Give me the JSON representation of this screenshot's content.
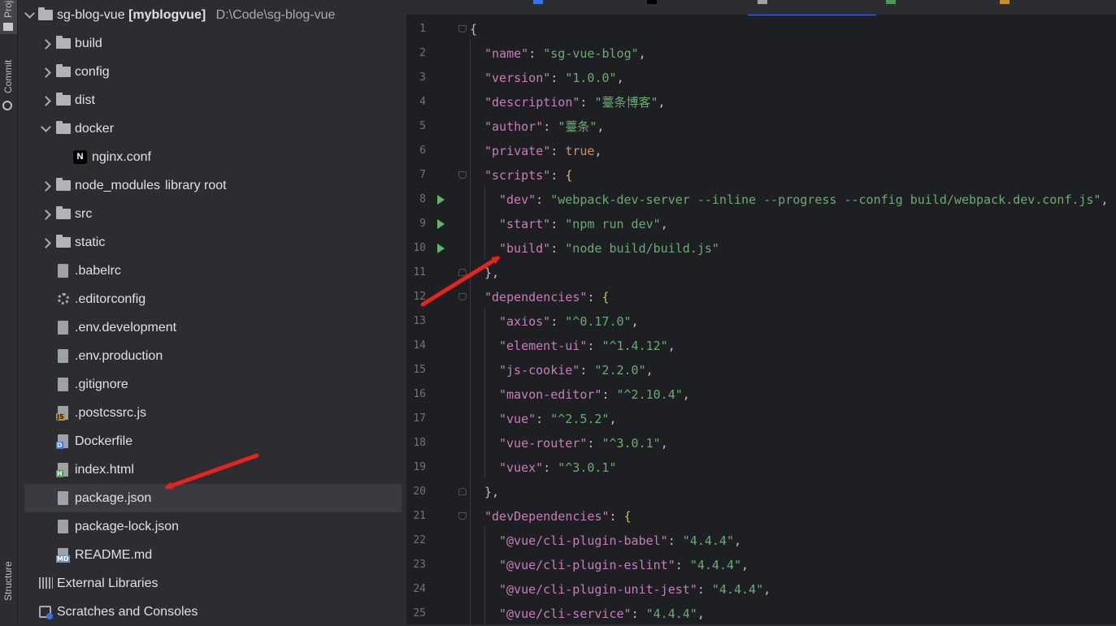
{
  "toolstrip": {
    "project_label": "Project",
    "commit_label": "Commit",
    "structure_label": "Structure"
  },
  "project_tree": {
    "root": {
      "name": "sg-blog-vue",
      "module": "[myblogvue]",
      "path": "D:\\Code\\sg-blog-vue"
    },
    "items": [
      {
        "label": "build",
        "type": "folder",
        "expanded": false
      },
      {
        "label": "config",
        "type": "folder",
        "expanded": false
      },
      {
        "label": "dist",
        "type": "folder",
        "expanded": false
      },
      {
        "label": "docker",
        "type": "folder",
        "expanded": true
      },
      {
        "label": "nginx.conf",
        "type": "nginx-file"
      },
      {
        "label": "node_modules",
        "suffix": "library root",
        "type": "folder",
        "expanded": false
      },
      {
        "label": "src",
        "type": "folder",
        "expanded": false
      },
      {
        "label": "static",
        "type": "folder",
        "expanded": false
      },
      {
        "label": ".babelrc",
        "type": "json-file"
      },
      {
        "label": ".editorconfig",
        "type": "settings-file"
      },
      {
        "label": ".env.development",
        "type": "text-file"
      },
      {
        "label": ".env.production",
        "type": "text-file"
      },
      {
        "label": ".gitignore",
        "type": "ignore-file"
      },
      {
        "label": ".postcssrc.js",
        "type": "js-file",
        "badge": "JS"
      },
      {
        "label": "Dockerfile",
        "type": "docker-file",
        "badge": "D"
      },
      {
        "label": "index.html",
        "type": "html-file",
        "badge": "H"
      },
      {
        "label": "package.json",
        "type": "json-file",
        "selected": true
      },
      {
        "label": "package-lock.json",
        "type": "json-file"
      },
      {
        "label": "README.md",
        "type": "md-file",
        "badge": "MD"
      }
    ],
    "external_libraries": "External Libraries",
    "scratches": "Scratches and Consoles"
  },
  "editor": {
    "lines": [
      {
        "n": "1",
        "code": "{"
      },
      {
        "n": "2",
        "key": "\"name\"",
        "value": "\"sg-vue-blog\"",
        "trail": ","
      },
      {
        "n": "3",
        "key": "\"version\"",
        "value": "\"1.0.0\"",
        "trail": ","
      },
      {
        "n": "4",
        "key": "\"description\"",
        "value": "\"薹条博客\"",
        "trail": ","
      },
      {
        "n": "5",
        "key": "\"author\"",
        "value": "\"薹条\"",
        "trail": ","
      },
      {
        "n": "6",
        "key": "\"private\"",
        "keyword": "true",
        "trail": ","
      },
      {
        "n": "7",
        "key": "\"scripts\"",
        "open": "{"
      },
      {
        "n": "8",
        "key": "\"dev\"",
        "value": "\"webpack-dev-server --inline --progress --config build/webpack.dev.conf.js\"",
        "trail": ","
      },
      {
        "n": "9",
        "key": "\"start\"",
        "value": "\"npm run dev\"",
        "trail": ","
      },
      {
        "n": "10",
        "key": "\"build\"",
        "value": "\"node build/build.js\"",
        "trail": ""
      },
      {
        "n": "11",
        "code": "},"
      },
      {
        "n": "12",
        "key": "\"dependencies\"",
        "open": "{"
      },
      {
        "n": "13",
        "key": "\"axios\"",
        "value": "\"^0.17.0\"",
        "trail": ","
      },
      {
        "n": "14",
        "key": "\"element-ui\"",
        "value": "\"^1.4.12\"",
        "trail": ","
      },
      {
        "n": "15",
        "key": "\"js-cookie\"",
        "value": "\"2.2.0\"",
        "trail": ","
      },
      {
        "n": "16",
        "key": "\"mavon-editor\"",
        "value": "\"^2.10.4\"",
        "trail": ","
      },
      {
        "n": "17",
        "key": "\"vue\"",
        "value": "\"^2.5.2\"",
        "trail": ","
      },
      {
        "n": "18",
        "key": "\"vue-router\"",
        "value": "\"^3.0.1\"",
        "trail": ","
      },
      {
        "n": "19",
        "key": "\"vuex\"",
        "value": "\"^3.0.1\"",
        "trail": ""
      },
      {
        "n": "20",
        "code": "},"
      },
      {
        "n": "21",
        "key": "\"devDependencies\"",
        "open": "{"
      },
      {
        "n": "22",
        "key": "\"@vue/cli-plugin-babel\"",
        "value": "\"4.4.4\"",
        "trail": ","
      },
      {
        "n": "23",
        "key": "\"@vue/cli-plugin-eslint\"",
        "value": "\"4.4.4\"",
        "trail": ","
      },
      {
        "n": "24",
        "key": "\"@vue/cli-plugin-unit-jest\"",
        "value": "\"4.4.4\"",
        "trail": ","
      },
      {
        "n": "25",
        "key": "\"@vue/cli-service\"",
        "value": "\"4.4.4\"",
        "trail": ","
      }
    ]
  },
  "colors": {
    "panel_bg": "#2b2d30",
    "editor_bg": "#1e1f22",
    "json_key": "#c77dbb",
    "json_string": "#6aab73",
    "json_keyword": "#cf8e6d",
    "run_icon": "#5fb865",
    "annotation_arrow": "#e8231e"
  }
}
